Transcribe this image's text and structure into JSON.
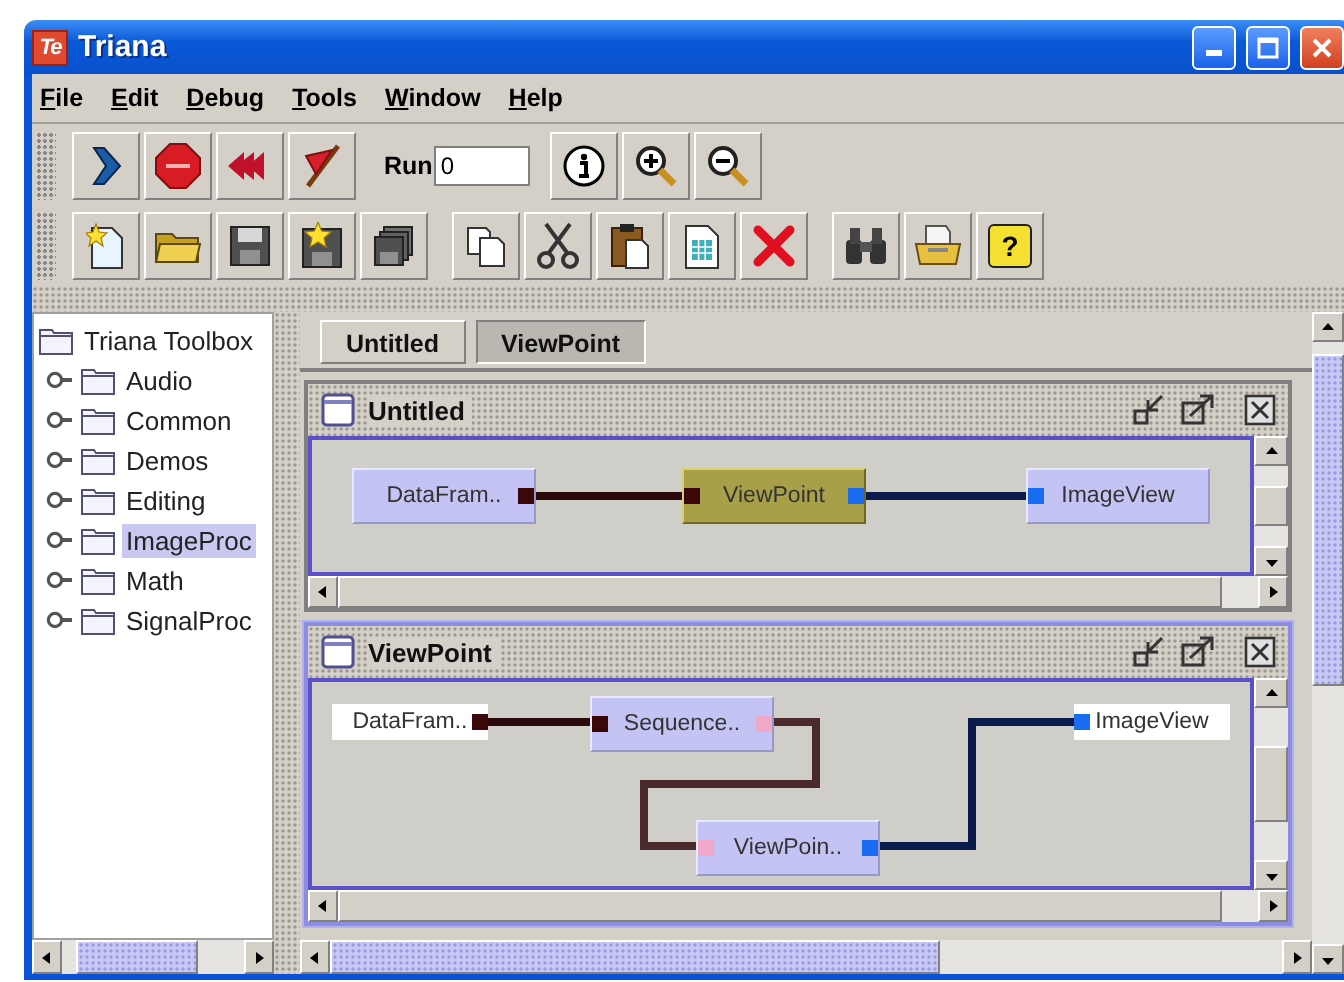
{
  "window": {
    "title": "Triana",
    "logo_text": "Te"
  },
  "menu": [
    {
      "label": "File"
    },
    {
      "label": "Edit"
    },
    {
      "label": "Debug"
    },
    {
      "label": "Tools"
    },
    {
      "label": "Window"
    },
    {
      "label": "Help"
    }
  ],
  "toolbar": {
    "run_label": "Run",
    "run_value": "0",
    "help_glyph": "?"
  },
  "toolbox": {
    "root": "Triana Toolbox",
    "children": [
      {
        "label": "Audio",
        "selected": false
      },
      {
        "label": "Common",
        "selected": false
      },
      {
        "label": "Demos",
        "selected": false
      },
      {
        "label": "Editing",
        "selected": false
      },
      {
        "label": "ImageProc",
        "selected": true
      },
      {
        "label": "Math",
        "selected": false
      },
      {
        "label": "SignalProc",
        "selected": false
      }
    ]
  },
  "tabs": [
    {
      "label": "Untitled",
      "selected": false
    },
    {
      "label": "ViewPoint",
      "selected": true
    }
  ],
  "workspaces": [
    {
      "title": "Untitled",
      "active": false,
      "nodes": [
        {
          "label": "DataFram..",
          "kind": "unit",
          "selected": false,
          "ports": [
            {
              "kind": "output",
              "color": "#3a0808"
            }
          ]
        },
        {
          "label": "ViewPoint",
          "kind": "unit",
          "selected": true,
          "ports": [
            {
              "kind": "input",
              "color": "#3a0808"
            },
            {
              "kind": "output",
              "color": "#1a6cf0"
            }
          ]
        },
        {
          "label": "ImageView",
          "kind": "unit",
          "selected": false,
          "ports": [
            {
              "kind": "input",
              "color": "#1a6cf0"
            }
          ]
        }
      ],
      "connections": [
        {
          "color": "#2a0a0a"
        },
        {
          "color": "#0a1a4a"
        }
      ]
    },
    {
      "title": "ViewPoint",
      "active": true,
      "nodes": [
        {
          "label": "DataFram..",
          "kind": "external",
          "selected": false,
          "ports": [
            {
              "kind": "output",
              "color": "#3a0808"
            }
          ]
        },
        {
          "label": "Sequence..",
          "kind": "unit",
          "selected": false,
          "ports": [
            {
              "kind": "input",
              "color": "#3a0808"
            },
            {
              "kind": "output",
              "color": "#f0a8c8"
            }
          ]
        },
        {
          "label": "ViewPoin..",
          "kind": "unit",
          "selected": false,
          "ports": [
            {
              "kind": "input",
              "color": "#f0a8c8"
            },
            {
              "kind": "output",
              "color": "#1a6cf0"
            }
          ]
        },
        {
          "label": "ImageView",
          "kind": "external",
          "selected": false,
          "ports": [
            {
              "kind": "input",
              "color": "#1a6cf0"
            }
          ]
        }
      ],
      "connections": [
        {
          "color": "#2a0a0a"
        },
        {
          "color": "#4a2a2a"
        },
        {
          "color": "#0a1a4a"
        }
      ]
    }
  ]
}
